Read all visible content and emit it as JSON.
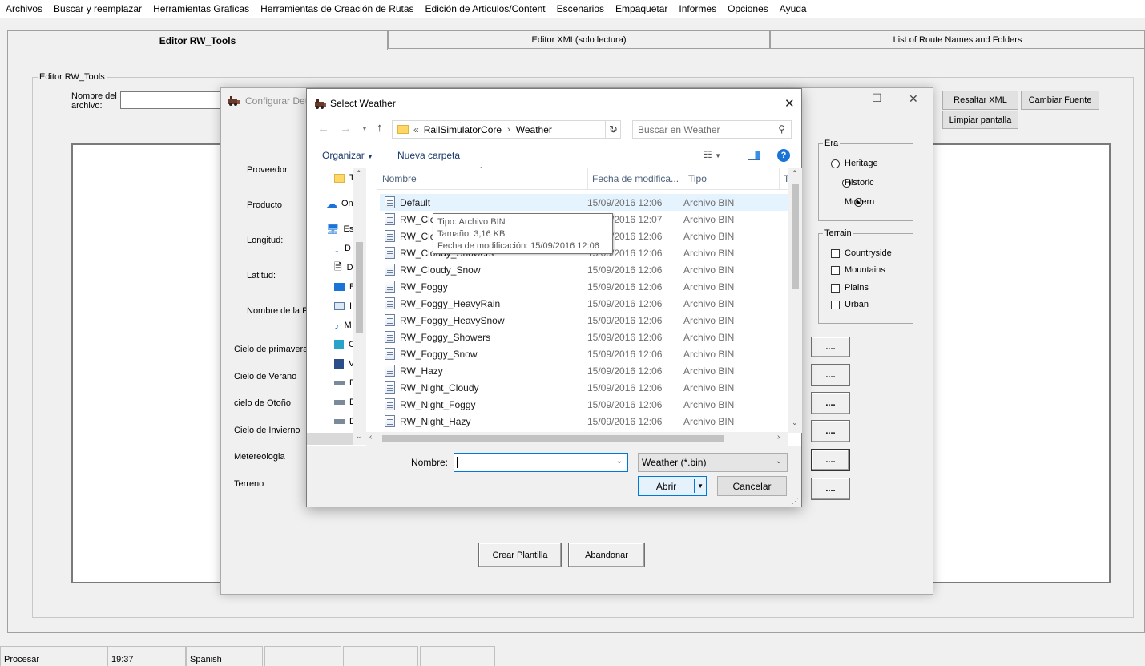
{
  "menu": [
    "Archivos",
    "Buscar y reemplazar",
    "Herramientas Graficas",
    "Herramientas de Creación de Rutas",
    "Edición de Articulos/Content",
    "Escenarios",
    "Empaquetar",
    "Informes",
    "Opciones",
    "Ayuda"
  ],
  "tabs": [
    "Editor RW_Tools",
    "Editor XML(solo lectura)",
    "List of Route Names and Folders"
  ],
  "editor": {
    "group_title": "Editor RW_Tools",
    "filename_label_1": "Nombre del",
    "filename_label_2": "archivo:",
    "filename_value": "",
    "btn_resaltar": "Resaltar XML",
    "btn_cambiar_fuente": "Cambiar Fuente",
    "btn_limpiar": "Limpiar pantalla"
  },
  "config_window": {
    "title": "Configurar Det",
    "fields": [
      "Proveedor",
      "Producto",
      "Longitud:",
      "Latitud:",
      "Nombre de la Pl"
    ],
    "sky_fields": [
      "Cielo de primavera",
      "Cielo de Verano",
      "cielo de Otoño",
      "Cielo de Invierno",
      "Metereologia",
      "Terreno"
    ],
    "browse_label": "....",
    "era": {
      "title": "Era",
      "options": [
        "Heritage",
        "Historic",
        "Modern"
      ],
      "selected": "Modern"
    },
    "terrain": {
      "title": "Terrain",
      "options": [
        "Countryside",
        "Mountains",
        "Plains",
        "Urban"
      ]
    },
    "btn_crear": "Crear Plantilla",
    "btn_abandonar": "Abandonar",
    "ctrl_minimize": "—",
    "ctrl_maximize": "☐",
    "ctrl_close": "✕"
  },
  "dialog": {
    "title": "Select Weather",
    "close": "✕",
    "path_prefix": "«",
    "path": [
      "RailSimulatorCore",
      "Weather"
    ],
    "search_placeholder": "Buscar en Weather",
    "organizar": "Organizar",
    "nueva_carpeta": "Nueva carpeta",
    "nav_items": [
      "T",
      "On",
      "Es",
      "D",
      "D",
      "E",
      "I",
      "M",
      "O",
      "V",
      "D",
      "D",
      "D"
    ],
    "columns": {
      "name": "Nombre",
      "date": "Fecha de modifica...",
      "type": "Tipo",
      "extra": "T"
    },
    "files": [
      {
        "name": "Default",
        "date": "15/09/2016 12:06",
        "type": "Archivo BIN"
      },
      {
        "name": "RW_Cle",
        "date": "15/09/2016 12:07",
        "type": "Archivo BIN"
      },
      {
        "name": "RW_Clo",
        "date": "15/09/2016 12:06",
        "type": "Archivo BIN"
      },
      {
        "name": "RW_Cloudy_Showers",
        "date": "15/09/2016 12:06",
        "type": "Archivo BIN"
      },
      {
        "name": "RW_Cloudy_Snow",
        "date": "15/09/2016 12:06",
        "type": "Archivo BIN"
      },
      {
        "name": "RW_Foggy",
        "date": "15/09/2016 12:06",
        "type": "Archivo BIN"
      },
      {
        "name": "RW_Foggy_HeavyRain",
        "date": "15/09/2016 12:06",
        "type": "Archivo BIN"
      },
      {
        "name": "RW_Foggy_HeavySnow",
        "date": "15/09/2016 12:06",
        "type": "Archivo BIN"
      },
      {
        "name": "RW_Foggy_Showers",
        "date": "15/09/2016 12:06",
        "type": "Archivo BIN"
      },
      {
        "name": "RW_Foggy_Snow",
        "date": "15/09/2016 12:06",
        "type": "Archivo BIN"
      },
      {
        "name": "RW_Hazy",
        "date": "15/09/2016 12:06",
        "type": "Archivo BIN"
      },
      {
        "name": "RW_Night_Cloudy",
        "date": "15/09/2016 12:06",
        "type": "Archivo BIN"
      },
      {
        "name": "RW_Night_Foggy",
        "date": "15/09/2016 12:06",
        "type": "Archivo BIN"
      },
      {
        "name": "RW_Night_Hazy",
        "date": "15/09/2016 12:06",
        "type": "Archivo BIN"
      }
    ],
    "tooltip": {
      "tipo": "Tipo: Archivo BIN",
      "tamano": "Tamaño: 3,16 KB",
      "fecha": "Fecha de modificación: 15/09/2016 12:06"
    },
    "filename_label": "Nombre:",
    "filename_value": "",
    "filter": "Weather (*.bin)",
    "btn_open": "Abrir",
    "btn_cancel": "Cancelar"
  },
  "statusbar": [
    "Procesar",
    "19:37",
    "Spanish",
    "",
    "",
    ""
  ],
  "colors": {
    "accent": "#0078d7",
    "selected_row": "#e5f3ff",
    "folder": "#ffd766"
  }
}
